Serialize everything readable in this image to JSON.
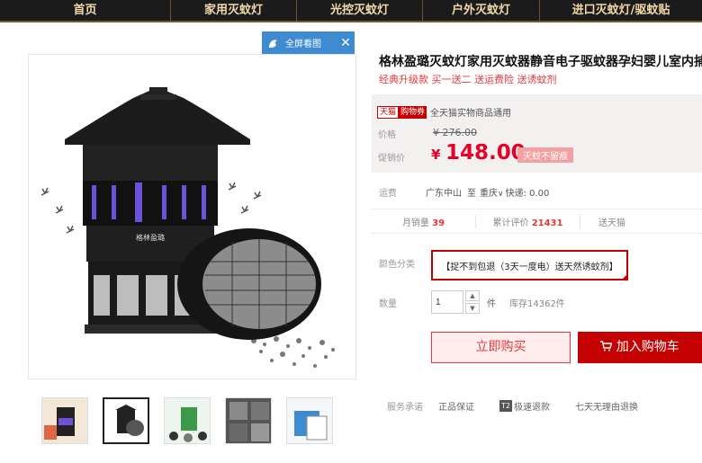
{
  "nav": {
    "items": [
      "首页",
      "家用灭蚊灯",
      "光控灭蚊灯",
      "户外灭蚊灯",
      "进口灭蚊灯/驱蚊贴"
    ]
  },
  "gallery": {
    "fullscreen_label": "全屏看图",
    "product_brand_text": "格林盈璐"
  },
  "product": {
    "title": "格林盈璐灭蚊灯家用灭蚊器静音电子驱蚊器孕妇婴儿室内捕",
    "subtitle": "经典升级款 买一送二 送运费险 送诱蚊剂"
  },
  "price": {
    "tag_tmall": "天猫",
    "tag_coupon": "购物券",
    "promo_text": "全天猫实物商品通用",
    "price_label": "价格",
    "original": "¥ 276.00",
    "promo_label": "促销价",
    "currency": "¥",
    "sale": "148.00",
    "badge": "灭蚊不留痕"
  },
  "shipping": {
    "label": "运费",
    "from": "广东中山",
    "to_prefix": "至",
    "to": "重庆",
    "fee": "快递: 0.00"
  },
  "stats": {
    "monthly_label": "月销量",
    "monthly_value": "39",
    "reviews_label": "累计评价",
    "reviews_value": "21431",
    "points_label": "送天猫"
  },
  "options": {
    "color_label": "颜色分类",
    "color_value": "【捉不到包退（3天一度电）送天然诱蚊剂】",
    "qty_label": "数量",
    "qty_value": "1",
    "qty_unit": "件",
    "stock": "库存14362件"
  },
  "actions": {
    "buy_now": "立即购买",
    "add_cart": "加入购物车"
  },
  "promise": {
    "label": "服务承诺",
    "items": [
      "正品保证",
      "极速退款",
      "七天无理由退换"
    ],
    "t2": "T2"
  },
  "colors": {
    "accent": "#c40000",
    "price_red": "#e4002b",
    "nav_bg": "#1b1b1b",
    "nav_text": "#f0d9a8",
    "fullscreen_blue": "#3f8bd1"
  }
}
